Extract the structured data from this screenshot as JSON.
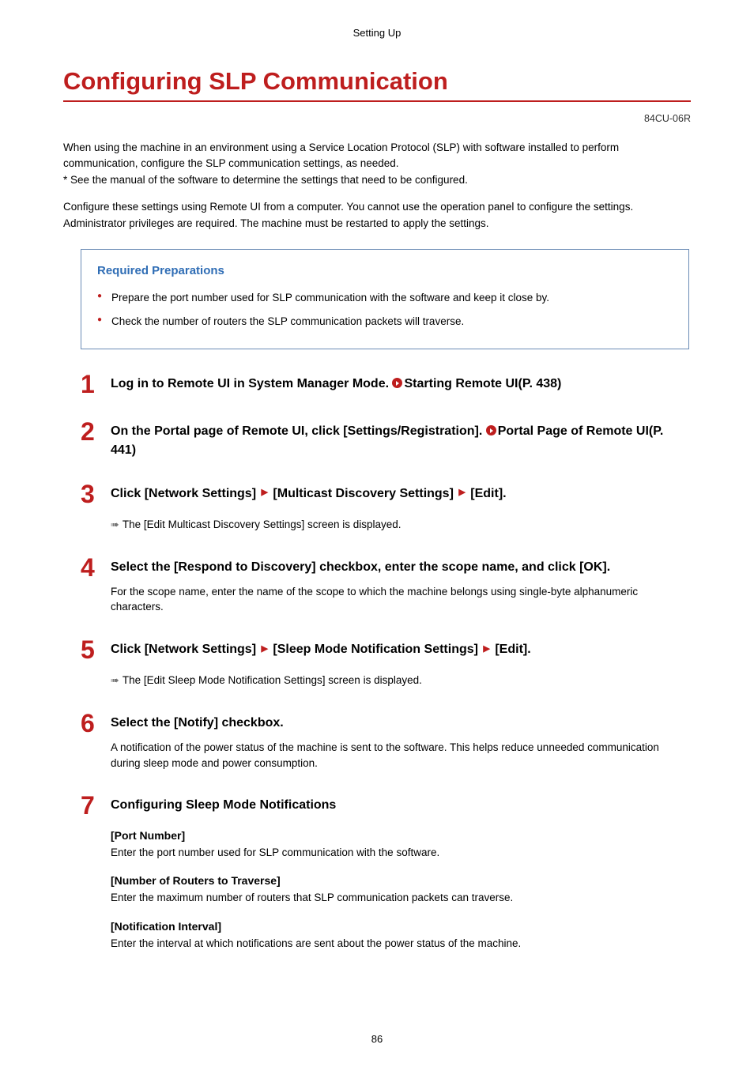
{
  "header": {
    "section": "Setting Up"
  },
  "title": "Configuring SLP Communication",
  "doc_code": "84CU-06R",
  "intro": {
    "p1": "When using the machine in an environment using a Service Location Protocol (SLP) with software installed to perform communication, configure the SLP communication settings, as needed.",
    "p2": "* See the manual of the software to determine the settings that need to be configured.",
    "p3": "Configure these settings using Remote UI from a computer. You cannot use the operation panel to configure the settings.",
    "p4": "Administrator privileges are required. The machine must be restarted to apply the settings."
  },
  "required": {
    "title": "Required Preparations",
    "items": [
      "Prepare the port number used for SLP communication with the software and keep it close by.",
      "Check the number of routers the SLP communication packets will traverse."
    ]
  },
  "steps": [
    {
      "num": "1",
      "heading_before": "Log in to Remote UI in System Manager Mode. ",
      "link": "Starting Remote UI(P. 438)"
    },
    {
      "num": "2",
      "heading_before": "On the Portal page of Remote UI, click [Settings/Registration]. ",
      "link": "Portal Page of Remote UI(P. 441)"
    },
    {
      "num": "3",
      "heading_parts": [
        "Click [Network Settings]",
        "[Multicast Discovery Settings]",
        "[Edit]."
      ],
      "result": "The [Edit Multicast Discovery Settings] screen is displayed."
    },
    {
      "num": "4",
      "heading_plain": "Select the [Respond to Discovery] checkbox, enter the scope name, and click [OK].",
      "desc": "For the scope name, enter the name of the scope to which the machine belongs using single-byte alphanumeric characters."
    },
    {
      "num": "5",
      "heading_parts": [
        "Click [Network Settings]",
        "[Sleep Mode Notification Settings]",
        "[Edit]."
      ],
      "result": "The [Edit Sleep Mode Notification Settings] screen is displayed."
    },
    {
      "num": "6",
      "heading_plain": "Select the [Notify] checkbox.",
      "desc": "A notification of the power status of the machine is sent to the software. This helps reduce unneeded communication during sleep mode and power consumption."
    },
    {
      "num": "7",
      "heading_plain": "Configuring Sleep Mode Notifications",
      "subs": [
        {
          "h": "[Port Number]",
          "d": "Enter the port number used for SLP communication with the software."
        },
        {
          "h": "[Number of Routers to Traverse]",
          "d": "Enter the maximum number of routers that SLP communication packets can traverse."
        },
        {
          "h": "[Notification Interval]",
          "d": "Enter the interval at which notifications are sent about the power status of the machine."
        }
      ]
    }
  ],
  "page_num": "86"
}
